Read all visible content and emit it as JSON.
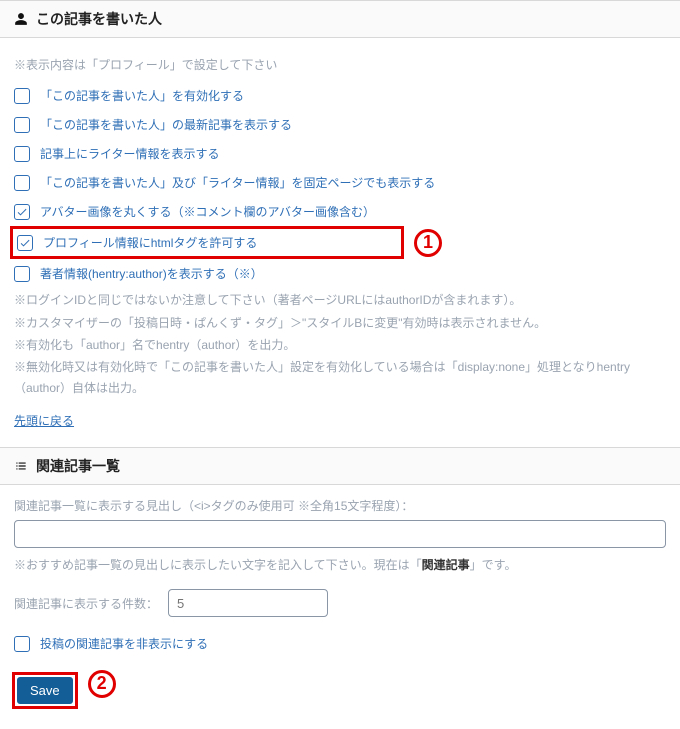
{
  "section1": {
    "title": "この記事を書いた人",
    "intro_note": "※表示内容は「プロフィール」で設定して下さい",
    "checks": {
      "c1": {
        "label": "「この記事を書いた人」を有効化する",
        "checked": false
      },
      "c2": {
        "label": "「この記事を書いた人」の最新記事を表示する",
        "checked": false
      },
      "c3": {
        "label": "記事上にライター情報を表示する",
        "checked": false
      },
      "c4": {
        "label": "「この記事を書いた人」及び「ライター情報」を固定ページでも表示する",
        "checked": false
      },
      "c5": {
        "label": "アバター画像を丸くする（※コメント欄のアバター画像含む）",
        "checked": true
      },
      "c6": {
        "label": "プロフィール情報にhtmlタグを許可する",
        "checked": true
      },
      "c7": {
        "label": "著者情報(hentry:author)を表示する（※）",
        "checked": false
      }
    },
    "foot_notes": {
      "n1": "※ログインIDと同じではないか注意して下さい（著者ページURLにはauthorIDが含まれます）。",
      "n2": "※カスタマイザーの「投稿日時・ぱんくず・タグ」＞\"スタイルBに変更\"有効時は表示されません。",
      "n3": "※有効化も「author」名でhentry（author）を出力。",
      "n4": "※無効化時又は有効化時で「この記事を書いた人」設定を有効化している場合は「display:none」処理となりhentry（author）自体は出力。"
    },
    "back_link": "先頭に戻る"
  },
  "section2": {
    "title": "関連記事一覧",
    "heading_field_label": "関連記事一覧に表示する見出し（<i>タグのみ使用可 ※全角15文字程度）：",
    "heading_value": "",
    "heading_help_prefix": "※おすすめ記事一覧の見出しに表示したい文字を記入して下さい。現在は「",
    "heading_help_strong": "関連記事",
    "heading_help_suffix": "」です。",
    "count_label": "関連記事に表示する件数：",
    "count_placeholder": "5",
    "hide_label": "投稿の関連記事を非表示にする",
    "save_label": "Save"
  },
  "callouts": {
    "num1": "1",
    "num2": "2"
  }
}
